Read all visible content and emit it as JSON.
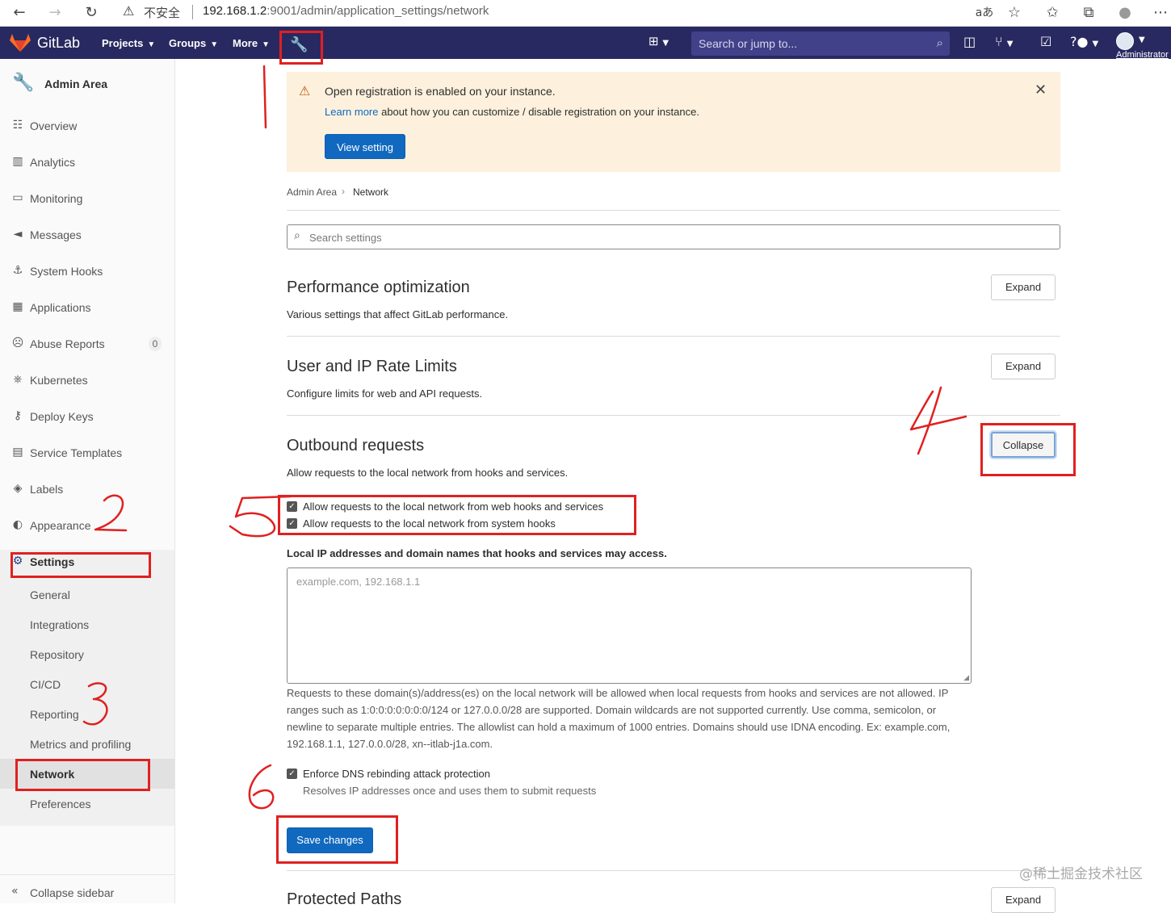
{
  "browser": {
    "insecure_label": "不安全",
    "url_host": "192.168.1.2",
    "url_rest": ":9001/admin/application_settings/network",
    "icons": [
      "back-icon",
      "forward-icon",
      "reload-icon",
      "warning-icon",
      "read-aloud-icon",
      "favorite-add-icon",
      "favorites-icon",
      "collections-icon",
      "profile-icon",
      "more-icon"
    ]
  },
  "navbar": {
    "brand": "GitLab",
    "projects": "Projects",
    "groups": "Groups",
    "more": "More",
    "search_placeholder": "Search or jump to...",
    "user_label": "Administrator",
    "bg_color": "#292961"
  },
  "sidebar": {
    "title": "Admin Area",
    "items": [
      {
        "label": "Overview",
        "icon": "overview-icon"
      },
      {
        "label": "Analytics",
        "icon": "analytics-icon"
      },
      {
        "label": "Monitoring",
        "icon": "monitoring-icon"
      },
      {
        "label": "Messages",
        "icon": "messages-icon"
      },
      {
        "label": "System Hooks",
        "icon": "hooks-icon"
      },
      {
        "label": "Applications",
        "icon": "applications-icon"
      },
      {
        "label": "Abuse Reports",
        "icon": "abuse-icon",
        "badge": "0"
      },
      {
        "label": "Kubernetes",
        "icon": "kubernetes-icon"
      },
      {
        "label": "Deploy Keys",
        "icon": "key-icon"
      },
      {
        "label": "Service Templates",
        "icon": "templates-icon"
      },
      {
        "label": "Labels",
        "icon": "label-icon"
      },
      {
        "label": "Appearance",
        "icon": "appearance-icon"
      }
    ],
    "settings_label": "Settings",
    "settings_sub": [
      "General",
      "Integrations",
      "Repository",
      "CI/CD",
      "Reporting",
      "Metrics and profiling",
      "Network",
      "Preferences"
    ],
    "collapse_label": "Collapse sidebar"
  },
  "alert": {
    "title": "Open registration is enabled on your instance.",
    "link": "Learn more",
    "body": " about how you can customize / disable registration on your instance.",
    "button": "View setting",
    "bg_color": "#fdf1dd"
  },
  "breadcrumb": {
    "parent": "Admin Area",
    "current": "Network"
  },
  "search_settings_placeholder": "Search settings",
  "sections": {
    "perf": {
      "title": "Performance optimization",
      "desc": "Various settings that affect GitLab performance.",
      "button": "Expand"
    },
    "rate": {
      "title": "User and IP Rate Limits",
      "desc": "Configure limits for web and API requests.",
      "button": "Expand"
    },
    "outbound": {
      "title": "Outbound requests",
      "desc": "Allow requests to the local network from hooks and services.",
      "button": "Collapse"
    },
    "protected": {
      "title": "Protected Paths",
      "button": "Expand"
    }
  },
  "outbound": {
    "chk_web": "Allow requests to the local network from web hooks and services",
    "chk_system": "Allow requests to the local network from system hooks",
    "field_label": "Local IP addresses and domain names that hooks and services may access.",
    "field_placeholder": "example.com, 192.168.1.1",
    "help": "Requests to these domain(s)/address(es) on the local network will be allowed when local requests from hooks and services are not allowed. IP ranges such as 1:0:0:0:0:0:0:0/124 or 127.0.0.0/28 are supported. Domain wildcards are not supported currently. Use comma, semicolon, or newline to separate multiple entries. The allowlist can hold a maximum of 1000 entries. Domains should use IDNA encoding. Ex: example.com, 192.168.1.1, 127.0.0.0/28, xn--itlab-j1a.com.",
    "dns_label": "Enforce DNS rebinding attack protection",
    "dns_desc": "Resolves IP addresses once and uses them to submit requests",
    "save": "Save changes"
  },
  "watermark": "@稀土掘金技术社区",
  "annotation_color": "#e02020"
}
